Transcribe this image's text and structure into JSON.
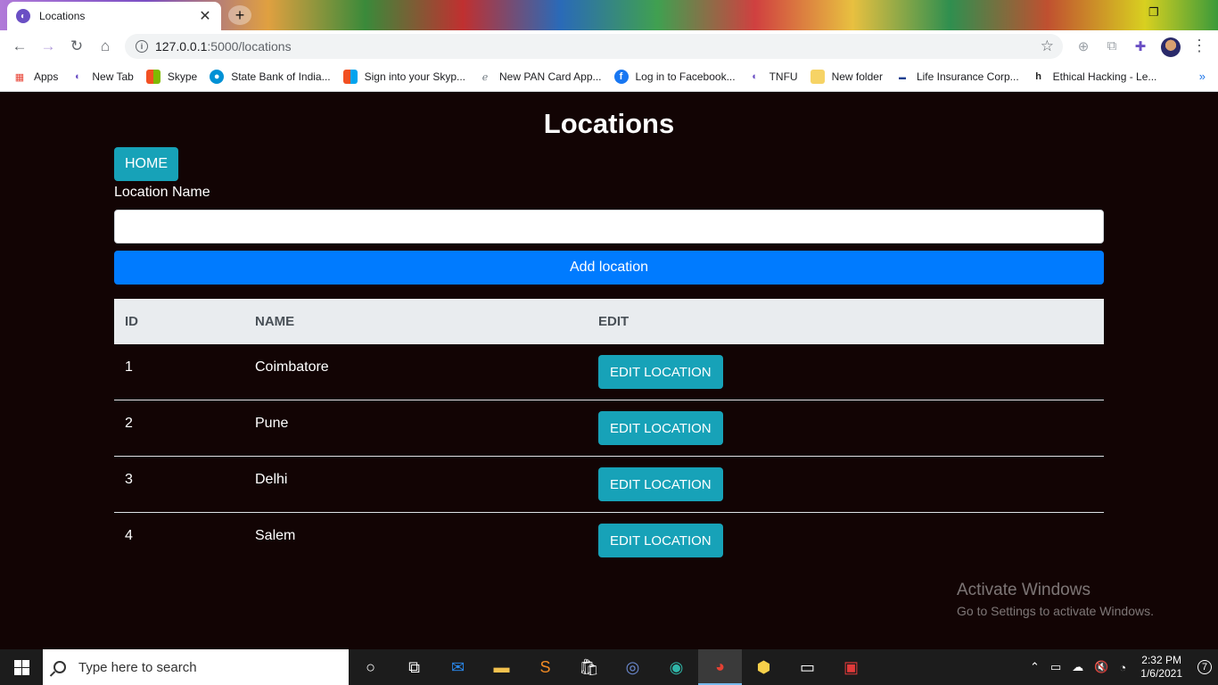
{
  "browser": {
    "tab_title": "Locations",
    "url_host": "127.0.0.1",
    "url_path": ":5000/locations",
    "bookmarks": [
      {
        "label": "Apps",
        "icon": "apps-grid-icon",
        "color": "#e84335"
      },
      {
        "label": "New Tab",
        "icon": "chrome-icon",
        "color": "#6a4fc4"
      },
      {
        "label": "Skype",
        "icon": "windows-logo-icon",
        "color": "#f25022"
      },
      {
        "label": "State Bank of India...",
        "icon": "sbi-icon",
        "color": "#0091d5"
      },
      {
        "label": "Sign into your Skyp...",
        "icon": "windows-logo-icon",
        "color": "#f25022"
      },
      {
        "label": "New PAN Card App...",
        "icon": "edge-legacy-icon",
        "color": "#6c757d"
      },
      {
        "label": "Log in to Facebook...",
        "icon": "facebook-icon",
        "color": "#1877f2"
      },
      {
        "label": "TNFU",
        "icon": "chrome-icon",
        "color": "#6a4fc4"
      },
      {
        "label": "New folder",
        "icon": "folder-icon",
        "color": "#f6d365"
      },
      {
        "label": "Life Insurance Corp...",
        "icon": "lic-icon",
        "color": "#1a3f8f"
      },
      {
        "label": "Ethical Hacking - Le...",
        "icon": "h-logo-icon",
        "color": "#222222"
      }
    ]
  },
  "page": {
    "title": "Locations",
    "home_label": "HOME",
    "location_label": "Location Name",
    "location_value": "",
    "add_label": "Add location",
    "table": {
      "headers": {
        "id": "ID",
        "name": "NAME",
        "edit": "EDIT"
      },
      "rows": [
        {
          "id": "1",
          "name": "Coimbatore",
          "action": "EDIT LOCATION"
        },
        {
          "id": "2",
          "name": "Pune",
          "action": "EDIT LOCATION"
        },
        {
          "id": "3",
          "name": "Delhi",
          "action": "EDIT LOCATION"
        },
        {
          "id": "4",
          "name": "Salem",
          "action": "EDIT LOCATION"
        }
      ]
    }
  },
  "watermark": {
    "title": "Activate Windows",
    "subtitle": "Go to Settings to activate Windows."
  },
  "taskbar": {
    "search_placeholder": "Type here to search",
    "time": "2:32 PM",
    "date": "1/6/2021",
    "notification_count": "7"
  },
  "colors": {
    "page_bg": "#120404",
    "info_button": "#17a2b8",
    "primary_button": "#007bff",
    "table_header_bg": "#e9ecef"
  }
}
